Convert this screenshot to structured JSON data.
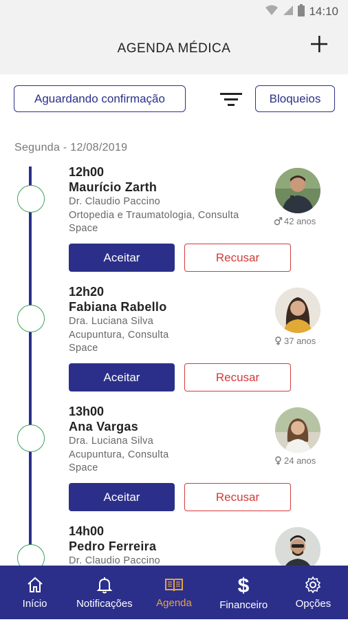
{
  "status_bar": {
    "time": "14:10",
    "icons": [
      "wifi-icon",
      "signal-icon",
      "battery-icon"
    ]
  },
  "header": {
    "title": "AGENDA MÉDICA",
    "add_icon": "plus-icon"
  },
  "filters": {
    "awaiting_label": "Aguardando confirmação",
    "filter_icon": "filter-icon",
    "blocks_label": "Bloqueios"
  },
  "agenda": {
    "date_label": "Segunda - 12/08/2019",
    "appointments": [
      {
        "time": "12h00",
        "patient": "Maurício Zarth",
        "doctor": "Dr. Claudio Paccino",
        "specialty": "Ortopedia e Traumatologia, Consulta",
        "place": "Space",
        "gender": "male",
        "age": "42 anos",
        "accept_label": "Aceitar",
        "reject_label": "Recusar"
      },
      {
        "time": "12h20",
        "patient": "Fabiana Rabello",
        "doctor": "Dra. Luciana Silva",
        "specialty": "Acupuntura, Consulta",
        "place": "Space",
        "gender": "female",
        "age": "37 anos",
        "accept_label": "Aceitar",
        "reject_label": "Recusar"
      },
      {
        "time": "13h00",
        "patient": "Ana Vargas",
        "doctor": "Dra. Luciana Silva",
        "specialty": "Acupuntura, Consulta",
        "place": "Space",
        "gender": "female",
        "age": "24 anos",
        "accept_label": "Aceitar",
        "reject_label": "Recusar"
      },
      {
        "time": "14h00",
        "patient": "Pedro Ferreira",
        "doctor": "Dr. Claudio Paccino",
        "specialty": "",
        "place": "",
        "gender": "male",
        "age": "",
        "accept_label": "",
        "reject_label": ""
      }
    ]
  },
  "bottom_nav": {
    "items": [
      {
        "label": "Início",
        "icon": "home-icon"
      },
      {
        "label": "Notificações",
        "icon": "bell-icon"
      },
      {
        "label": "Agenda",
        "icon": "book-icon",
        "active": true
      },
      {
        "label": "Financeiro",
        "icon": "dollar-icon"
      },
      {
        "label": "Opções",
        "icon": "gear-icon"
      }
    ]
  },
  "colors": {
    "primary": "#2b2f8a",
    "reject": "#d23a3a",
    "timeline_dot": "#3aa156",
    "active_nav": "#e8a24a"
  }
}
